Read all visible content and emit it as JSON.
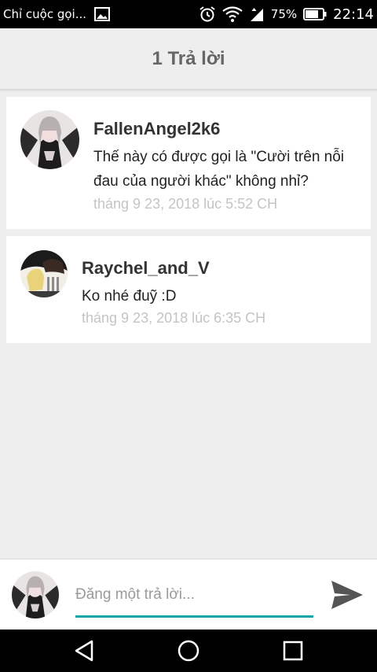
{
  "status_bar": {
    "notification_text": "Chỉ cuộc gọi...",
    "battery": "75%",
    "time": "22:14",
    "icons": [
      "image-icon",
      "alarm-icon",
      "wifi-icon",
      "data-signal-icon",
      "battery-icon"
    ]
  },
  "header": {
    "title": "1 Trả lời"
  },
  "comments": [
    {
      "username": "FallenAngel2k6",
      "text": "Thế này có được gọi là \"Cười trên nỗi đau của người khác\" không nhỉ?",
      "timestamp": "tháng 9 23, 2018 lúc 5:52 CH"
    },
    {
      "username": "Raychel_and_V",
      "text": "Ko nhé đuỹ :D",
      "timestamp": "tháng 9 23, 2018 lúc 6:35 CH"
    }
  ],
  "compose": {
    "placeholder": "Đăng một trả lời...",
    "value": ""
  },
  "colors": {
    "accent": "#1aa3a8",
    "send_icon": "#555555",
    "timestamp": "#c4c4c4"
  }
}
